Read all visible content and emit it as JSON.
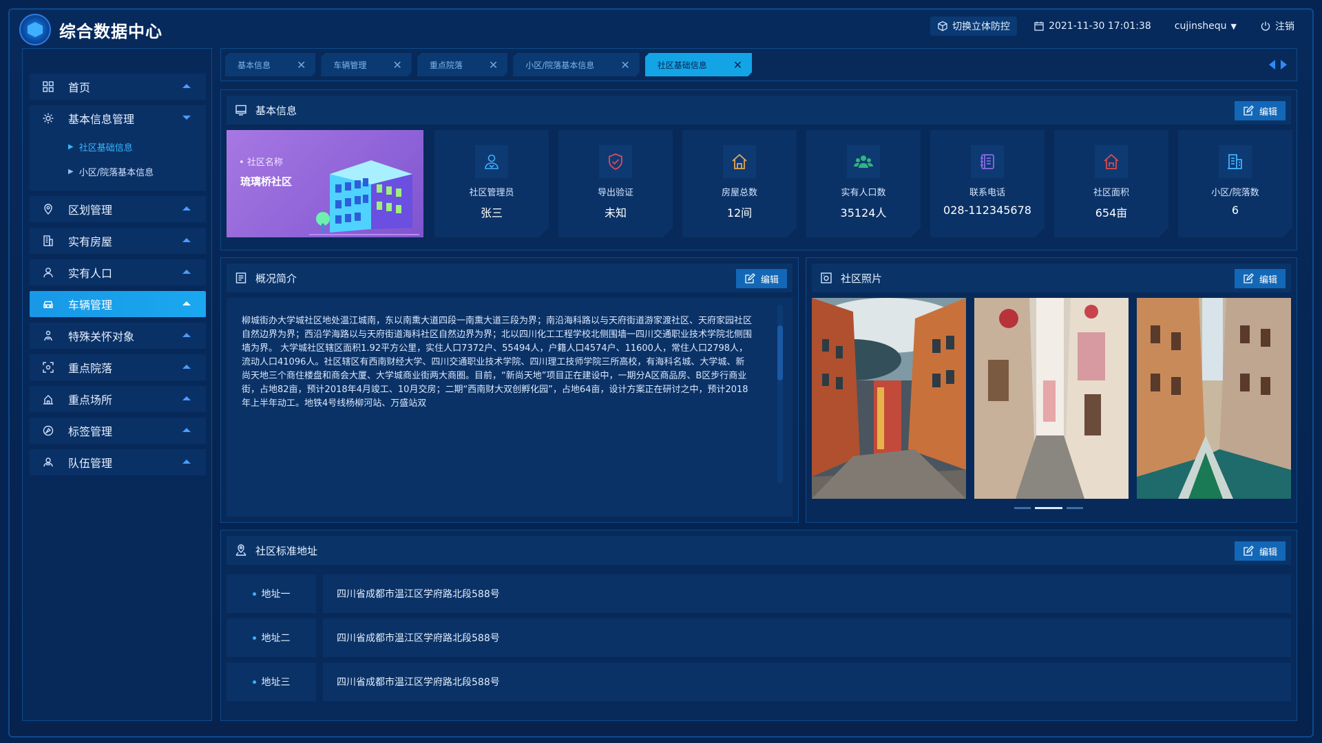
{
  "app": {
    "title": "综合数据中心"
  },
  "header": {
    "switch_label": "切换立体防控",
    "datetime": "2021-11-30  17:01:38",
    "username": "cujinshequ",
    "logout_label": "注销"
  },
  "sidebar": {
    "items": [
      {
        "label": "首页",
        "icon": "grid-icon",
        "active": false
      },
      {
        "label": "基本信息管理",
        "icon": "settings-icon",
        "active": false,
        "expanded": true,
        "children": [
          {
            "label": "社区基础信息",
            "active": true
          },
          {
            "label": "小区/院落基本信息",
            "active": false
          }
        ]
      },
      {
        "label": "区划管理",
        "icon": "map-pin-icon",
        "active": false
      },
      {
        "label": "实有房屋",
        "icon": "building-icon",
        "active": false
      },
      {
        "label": "实有人口",
        "icon": "user-icon",
        "active": false
      },
      {
        "label": "车辆管理",
        "icon": "car-icon",
        "active": true
      },
      {
        "label": "特殊关怀对象",
        "icon": "care-icon",
        "active": false
      },
      {
        "label": "重点院落",
        "icon": "focus-icon",
        "active": false
      },
      {
        "label": "重点场所",
        "icon": "venue-icon",
        "active": false
      },
      {
        "label": "标签管理",
        "icon": "tag-icon",
        "active": false
      },
      {
        "label": "队伍管理",
        "icon": "team-icon",
        "active": false
      }
    ]
  },
  "tabs": [
    {
      "label": "基本信息",
      "active": false
    },
    {
      "label": "车辆管理",
      "active": false
    },
    {
      "label": "重点院落",
      "active": false
    },
    {
      "label": "小区/院落基本信息",
      "active": false
    },
    {
      "label": "社区基础信息",
      "active": true
    }
  ],
  "basic_info": {
    "title": "基本信息",
    "edit_label": "编辑",
    "cover": {
      "label": "社区名称",
      "name": "琉璃桥社区"
    },
    "stats": [
      {
        "label": "社区管理员",
        "value": "张三",
        "icon": "admin-icon",
        "color": "#3fb0ff"
      },
      {
        "label": "导出验证",
        "value": "未知",
        "icon": "shield-icon",
        "color": "#e04a5a"
      },
      {
        "label": "房屋总数",
        "value": "12间",
        "icon": "house-icon",
        "color": "#e8a84a"
      },
      {
        "label": "实有人口数",
        "value": "35124人",
        "icon": "people-icon",
        "color": "#2fb67a"
      },
      {
        "label": "联系电话",
        "value": "028-112345678",
        "icon": "phone-book-icon",
        "color": "#8a6ae8"
      },
      {
        "label": "社区面积",
        "value": "654亩",
        "icon": "area-icon",
        "color": "#e04a4a"
      },
      {
        "label": "小区/院落数",
        "value": "6",
        "icon": "courtyard-icon",
        "color": "#3fb0ff"
      }
    ]
  },
  "overview": {
    "title": "概况简介",
    "edit_label": "编辑",
    "text": "柳城街办大学城社区地处温江城南，东以南熏大道四段一南熏大道三段为界；南沿海科路以与天府街道游家渡社区、天府家园社区自然边界为界；西沿学海路以与天府街道海科社区自然边界为界；北以四川化工工程学校北侧围墙一四川交通职业技术学院北侧围墙为界。  大学城社区辖区面积1.92平方公里，实住人口7372户、55494人，户籍人口4574户、11600人，常住人口2798人，流动人口41096人。社区辖区有西南财经大学、四川交通职业技术学院、四川理工技师学院三所高校，有海科名城、大学城、新尚天地三个商住楼盘和商会大厦、大学城商业街两大商圈。目前，“新尚天地”项目正在建设中，一期分A区商品房、B区步行商业街，占地82亩，预计2018年4月竣工、10月交房；二期“西南财大双创孵化园”，占地64亩，设计方案正在研讨之中，预计2018年上半年动工。地铁4号线杨柳河站、万盛站双"
  },
  "photos": {
    "title": "社区照片",
    "edit_label": "编辑",
    "items": [
      {
        "name": "street-photo-1"
      },
      {
        "name": "alley-photo-2"
      },
      {
        "name": "canal-photo-3"
      }
    ]
  },
  "address": {
    "title": "社区标准地址",
    "edit_label": "编辑",
    "rows": [
      {
        "label": "地址一",
        "value": "四川省成都市温江区学府路北段588号"
      },
      {
        "label": "地址二",
        "value": "四川省成都市温江区学府路北段588号"
      },
      {
        "label": "地址三",
        "value": "四川省成都市温江区学府路北段588号"
      }
    ]
  }
}
